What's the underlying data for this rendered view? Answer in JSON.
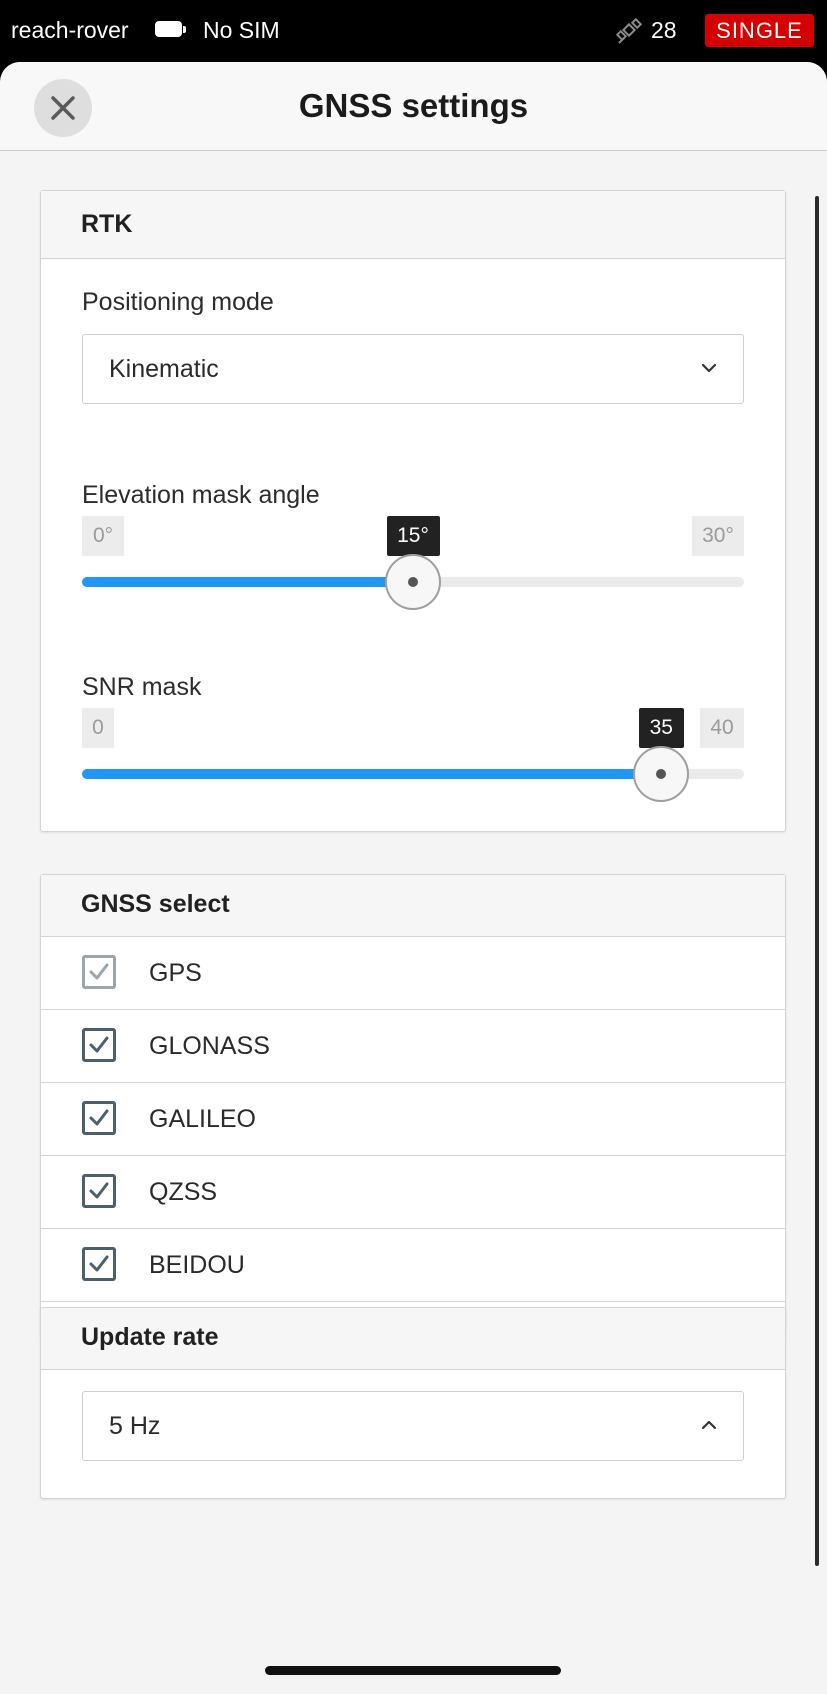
{
  "status_bar": {
    "device_name": "reach-rover",
    "sim_status": "No SIM",
    "satellite_icon": "satellite-icon",
    "satellite_count": "28",
    "solution_status": "SINGLE",
    "solution_color": "#d50000"
  },
  "header": {
    "title": "GNSS settings",
    "close_icon": "close-icon"
  },
  "rtk": {
    "section_title": "RTK",
    "positioning_mode": {
      "label": "Positioning mode",
      "value": "Kinematic"
    },
    "elevation_mask": {
      "label": "Elevation mask angle",
      "min_label": "0°",
      "max_label": "30°",
      "value_label": "15°",
      "min": 0,
      "max": 30,
      "value": 15
    },
    "snr_mask": {
      "label": "SNR mask",
      "min_label": "0",
      "max_label": "40",
      "value_label": "35",
      "min": 0,
      "max": 40,
      "value": 35
    },
    "accent_color": "#2196f3"
  },
  "gnss_select": {
    "section_title": "GNSS select",
    "systems": [
      {
        "name": "GPS",
        "checked": true,
        "disabled": true
      },
      {
        "name": "GLONASS",
        "checked": true,
        "disabled": false
      },
      {
        "name": "GALILEO",
        "checked": true,
        "disabled": false
      },
      {
        "name": "QZSS",
        "checked": true,
        "disabled": false
      },
      {
        "name": "BEIDOU",
        "checked": true,
        "disabled": false
      }
    ]
  },
  "update_rate": {
    "section_title": "Update rate",
    "value": "5 Hz"
  }
}
